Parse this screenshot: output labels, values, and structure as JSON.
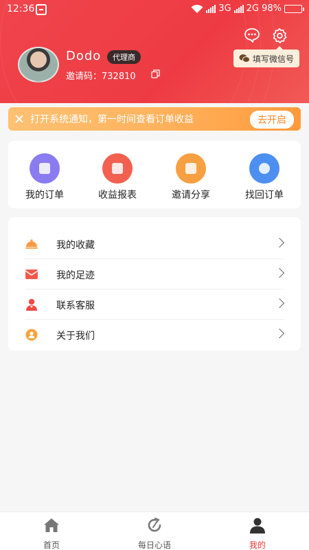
{
  "status_bar": {
    "time": "12:36",
    "network_1": "3G",
    "network_2": "2G",
    "battery": "98%",
    "icons": [
      "scan-icon",
      "wifi-icon",
      "signal-icon",
      "battery-icon"
    ]
  },
  "profile": {
    "username": "Dodo",
    "role_badge": "代理商",
    "invite_label": "邀请码：",
    "invite_code": "732810",
    "wechat_button": "填写微信号"
  },
  "notice": {
    "text": "打开系统通知，第一时间查看订单收益",
    "button": "去开启"
  },
  "orders": [
    {
      "label": "我的订单",
      "icon": "my-orders-icon",
      "color": "#8a7bf0"
    },
    {
      "label": "收益报表",
      "icon": "earnings-report-icon",
      "color": "#f2604f"
    },
    {
      "label": "邀请分享",
      "icon": "invite-share-icon",
      "color": "#f7a042"
    },
    {
      "label": "找回订单",
      "icon": "retrieve-order-icon",
      "color": "#4d8ff0"
    }
  ],
  "menu": [
    {
      "label": "我的收藏",
      "icon": "favorites-icon",
      "color": "#f89a44"
    },
    {
      "label": "我的足迹",
      "icon": "footprint-icon",
      "color": "#f15a4a"
    },
    {
      "label": "联系客服",
      "icon": "customer-service-icon",
      "color": "#ef4a44"
    },
    {
      "label": "关于我们",
      "icon": "about-us-icon",
      "color": "#f5a43e"
    }
  ],
  "tabbar": {
    "items": [
      {
        "label": "首页",
        "icon": "home-icon"
      },
      {
        "label": "每日心语",
        "icon": "daily-quote-icon"
      },
      {
        "label": "我的",
        "icon": "mine-icon"
      }
    ],
    "active": "我的",
    "active_color": "#e53935"
  }
}
